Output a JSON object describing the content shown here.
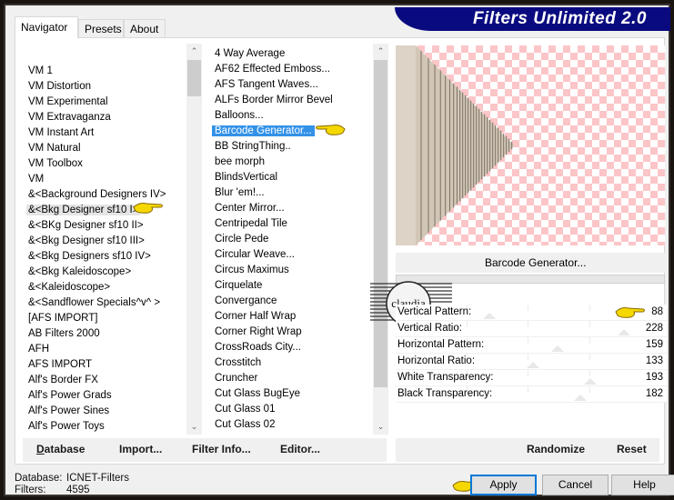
{
  "window": {
    "brand_title": "Filters Unlimited 2.0"
  },
  "tabs": [
    {
      "label": "Navigator",
      "active": true
    },
    {
      "label": "Presets",
      "active": false
    },
    {
      "label": "About",
      "active": false
    }
  ],
  "categories": {
    "items": [
      "VM 1",
      "VM Distortion",
      "VM Experimental",
      "VM Extravaganza",
      "VM Instant Art",
      "VM Natural",
      "VM Toolbox",
      "VM",
      "&<Background Designers IV>",
      "&<Bkg Designer sf10 I>",
      "&<BKg Designer sf10 II>",
      "&<Bkg Designer sf10 III>",
      "&<Bkg Designers sf10 IV>",
      "&<Bkg Kaleidoscope>",
      "&<Kaleidoscope>",
      "&<Sandflower Specials^v^ >",
      "[AFS IMPORT]",
      "AB Filters 2000",
      "AFH",
      "AFS IMPORT",
      "Alf's Border FX",
      "Alf's Power Grads",
      "Alf's Power Sines",
      "Alf's Power Toys"
    ],
    "selected": "&<Bkg Designer sf10 I>"
  },
  "filters": {
    "items": [
      "4 Way Average",
      "AF62 Effected Emboss...",
      "AFS Tangent Waves...",
      "ALFs Border Mirror Bevel",
      "Balloons...",
      "Barcode Generator...",
      "BB StringThing..",
      "bee morph",
      "BlindsVertical",
      "Blur 'em!...",
      "Center Mirror...",
      "Centripedal Tile",
      "Circle Pede",
      "Circular Weave...",
      "Circus Maximus",
      "Cirquelate",
      "Convergance",
      "Corner Half Wrap",
      "Corner Right Wrap",
      "CrossRoads City...",
      "Crosstitch",
      "Cruncher",
      "Cut Glass  BugEye",
      "Cut Glass 01",
      "Cut Glass 02"
    ],
    "selected": "Barcode Generator..."
  },
  "left_buttons": {
    "database": "Database",
    "import": "Import...",
    "filter_info": "Filter Info...",
    "editor": "Editor..."
  },
  "preview": {
    "filter_name": "Barcode Generator...",
    "watermark": "claudia"
  },
  "parameters": [
    {
      "label": "Vertical Pattern:",
      "value": 88
    },
    {
      "label": "Vertical Ratio:",
      "value": 228
    },
    {
      "label": "Horizontal Pattern:",
      "value": 159
    },
    {
      "label": "Horizontal Ratio:",
      "value": 133
    },
    {
      "label": "White Transparency:",
      "value": 193
    },
    {
      "label": "Black Transparency:",
      "value": 182
    }
  ],
  "param_max": 255,
  "right_buttons": {
    "randomize": "Randomize",
    "reset": "Reset"
  },
  "status": {
    "database_label": "Database:",
    "database_value": "ICNET-Filters",
    "filters_label": "Filters:",
    "filters_value": "4595"
  },
  "dialog_buttons": {
    "apply": "Apply",
    "cancel": "Cancel",
    "help": "Help"
  },
  "colors": {
    "brand_bg": "#0a0a80",
    "selection": "#3392e8",
    "checker": "#fcc5c8",
    "pointer": "#f5d800"
  }
}
